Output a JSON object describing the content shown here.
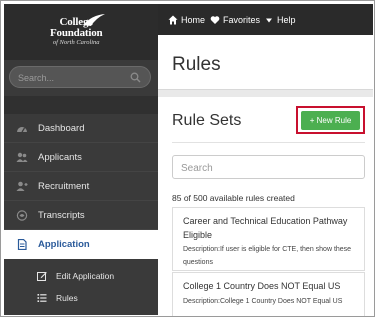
{
  "logo": {
    "line1": "College",
    "line2": "Foundation",
    "line3": "of North Carolina"
  },
  "sidebar": {
    "search_placeholder": "Search...",
    "items": [
      {
        "label": "Dashboard",
        "icon": "dashboard-icon"
      },
      {
        "label": "Applicants",
        "icon": "users-icon"
      },
      {
        "label": "Recruitment",
        "icon": "add-user-icon"
      },
      {
        "label": "Transcripts",
        "icon": "transcript-icon"
      },
      {
        "label": "Application",
        "icon": "document-icon",
        "active": true
      }
    ],
    "subitems": [
      {
        "label": "Edit Application",
        "icon": "edit-icon"
      },
      {
        "label": "Rules",
        "icon": "list-icon"
      }
    ]
  },
  "topbar": {
    "home": "Home",
    "favorites": "Favorites",
    "help": "Help"
  },
  "page": {
    "title": "Rules"
  },
  "rulesets": {
    "title": "Rule Sets",
    "new_rule": "New Rule",
    "search_placeholder": "Search",
    "count_text": "85 of 500 available rules created",
    "rules": [
      {
        "name": "Career and Technical Education Pathway Eligible",
        "description": "Description:If user is eligible for CTE, then show these questions"
      },
      {
        "name": "College 1 Country Does NOT Equal US",
        "description": "Description:College 1 Country Does NOT Equal US"
      }
    ]
  },
  "colors": {
    "sidebar_bg": "#3a3a3a",
    "topbar_bg": "#2a2a2a",
    "accent_green": "#4caf50",
    "highlight_red": "#c8102e",
    "active_text": "#2a5a9a"
  }
}
